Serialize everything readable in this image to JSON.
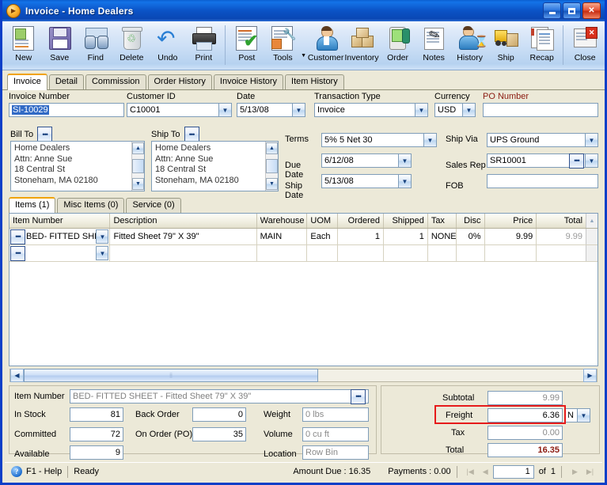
{
  "window": {
    "title": "Invoice - Home Dealers",
    "icon": "invoice-app-icon",
    "minimize": "_",
    "maximize": "□",
    "close": "✕"
  },
  "toolbar": {
    "items": [
      {
        "label": "New",
        "icon": "new-document-icon"
      },
      {
        "label": "Save",
        "icon": "floppy-disk-icon"
      },
      {
        "label": "Find",
        "icon": "binoculars-icon"
      },
      {
        "label": "Delete",
        "icon": "recycle-bin-icon"
      },
      {
        "label": "Undo",
        "icon": "undo-arrow-icon"
      },
      {
        "label": "Print",
        "icon": "printer-icon"
      },
      {
        "label": "Post",
        "icon": "post-checkmark-icon"
      },
      {
        "label": "Tools",
        "icon": "tools-wrench-icon"
      },
      {
        "label": "Customer",
        "icon": "customer-person-icon"
      },
      {
        "label": "Inventory",
        "icon": "inventory-boxes-icon"
      },
      {
        "label": "Order",
        "icon": "order-device-icon"
      },
      {
        "label": "Notes",
        "icon": "notepad-pen-icon"
      },
      {
        "label": "History",
        "icon": "history-hourglass-icon"
      },
      {
        "label": "Ship",
        "icon": "forklift-icon"
      },
      {
        "label": "Recap",
        "icon": "recap-pages-icon"
      },
      {
        "label": "Close",
        "icon": "close-window-icon"
      }
    ]
  },
  "tabs": [
    {
      "label": "Invoice",
      "active": true
    },
    {
      "label": "Detail",
      "active": false
    },
    {
      "label": "Commission",
      "active": false
    },
    {
      "label": "Order History",
      "active": false
    },
    {
      "label": "Invoice History",
      "active": false
    },
    {
      "label": "Item History",
      "active": false
    }
  ],
  "header_form": {
    "invoice_number": {
      "label": "Invoice Number",
      "value": "SI-10029",
      "selected": true
    },
    "customer_id": {
      "label": "Customer ID",
      "value": "C10001"
    },
    "date": {
      "label": "Date",
      "value": "5/13/08"
    },
    "transaction_type": {
      "label": "Transaction Type",
      "value": "Invoice"
    },
    "currency": {
      "label": "Currency",
      "value": "USD"
    },
    "po_number": {
      "label": "PO Number",
      "value": "",
      "label_color": "#8b1a10"
    }
  },
  "addresses": {
    "bill_to": {
      "label": "Bill To",
      "lines": [
        "Home Dealers",
        "Attn: Anne Sue",
        "18 Central St",
        "Stoneham, MA 02180"
      ]
    },
    "ship_to": {
      "label": "Ship To",
      "lines": [
        "Home Dealers",
        "Attn: Anne Sue",
        "18 Central St",
        "Stoneham, MA 02180"
      ]
    }
  },
  "terms_form": {
    "terms": {
      "label": "Terms",
      "value": "5% 5 Net 30"
    },
    "due_date": {
      "label": "Due Date",
      "value": "6/12/08"
    },
    "ship_date": {
      "label": "Ship Date",
      "value": "5/13/08"
    },
    "ship_via": {
      "label": "Ship Via",
      "value": "UPS Ground"
    },
    "sales_rep": {
      "label": "Sales Rep",
      "value": "SR10001"
    },
    "fob": {
      "label": "FOB",
      "value": ""
    }
  },
  "item_tabs": [
    {
      "label": "Items (1)",
      "active": true
    },
    {
      "label": "Misc Items (0)",
      "active": false
    },
    {
      "label": "Service (0)",
      "active": false
    }
  ],
  "grid": {
    "columns": [
      "Item Number",
      "Description",
      "Warehouse",
      "UOM",
      "Ordered",
      "Shipped",
      "Tax",
      "Disc",
      "Price",
      "Total"
    ],
    "rows": [
      {
        "item_number": "BED- FITTED SHEE",
        "description": "Fitted Sheet 79\" X 39\"",
        "warehouse": "MAIN",
        "uom": "Each",
        "ordered": "1",
        "shipped": "1",
        "tax": "NONE",
        "disc": "0%",
        "price": "9.99",
        "total": "9.99"
      },
      {
        "item_number": "",
        "description": "",
        "warehouse": "",
        "uom": "",
        "ordered": "",
        "shipped": "",
        "tax": "",
        "disc": "",
        "price": "",
        "total": ""
      }
    ]
  },
  "item_detail": {
    "item_number": {
      "label": "Item Number",
      "value": "BED- FITTED SHEET - Fitted Sheet 79\" X 39\""
    },
    "in_stock": {
      "label": "In Stock",
      "value": "81"
    },
    "committed": {
      "label": "Committed",
      "value": "72"
    },
    "available": {
      "label": "Available",
      "value": "9"
    },
    "back_order": {
      "label": "Back Order",
      "value": "0"
    },
    "on_order_po": {
      "label": "On Order (PO)",
      "value": "35"
    },
    "weight": {
      "label": "Weight",
      "value": "0 lbs"
    },
    "volume": {
      "label": "Volume",
      "value": "0 cu ft"
    },
    "location": {
      "label": "Location",
      "value": "Row  Bin"
    }
  },
  "totals": {
    "subtotal": {
      "label": "Subtotal",
      "value": "9.99"
    },
    "freight": {
      "label": "Freight",
      "value": "6.36",
      "taxable_flag": "N",
      "highlight_color": "#e61b1b"
    },
    "tax": {
      "label": "Tax",
      "value": "0.00"
    },
    "total": {
      "label": "Total",
      "value": "16.35",
      "color": "#8b1a10"
    }
  },
  "statusbar": {
    "help": "F1 - Help",
    "state": "Ready",
    "amount_due": "Amount Due : 16.35",
    "payments": "Payments : 0.00",
    "record": "1",
    "of_label": "of",
    "record_count": "1"
  }
}
